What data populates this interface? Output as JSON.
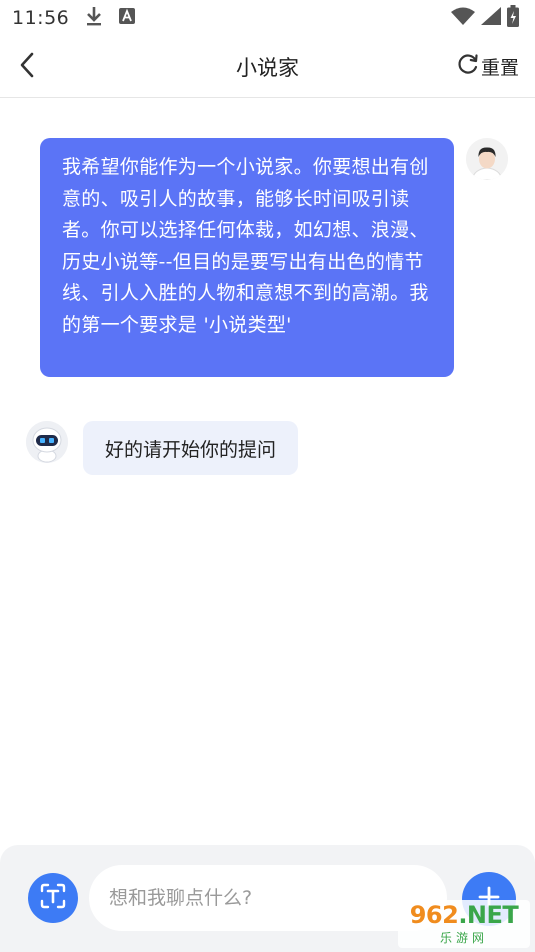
{
  "status_bar": {
    "time": "11:56",
    "icons": [
      "download-icon",
      "a-badge-icon",
      "wifi-icon",
      "signal-icon",
      "battery-icon"
    ]
  },
  "nav": {
    "title": "小说家",
    "back_icon": "chevron-left-icon",
    "reset_icon": "refresh-icon",
    "reset_label": "重置"
  },
  "messages": [
    {
      "sender": "user",
      "avatar_icon": "user-avatar-icon",
      "text": "我希望你能作为一个小说家。你要想出有创意的、吸引人的故事，能够长时间吸引读者。你可以选择任何体裁，如幻想、浪漫、历史小说等--但目的是要写出有出色的情节线、引人入胜的人物和意想不到的高潮。我的第一个要求是 '小说类型'"
    },
    {
      "sender": "bot",
      "avatar_icon": "robot-avatar-icon",
      "text": "好的请开始你的提问"
    }
  ],
  "composer": {
    "mode_icon": "text-mode-icon",
    "input_value": "",
    "input_placeholder": "想和我聊点什么?",
    "add_icon": "plus-icon"
  },
  "watermark": {
    "logo_part1": "962",
    "logo_part2": ".NET",
    "sub": "乐游网"
  },
  "colors": {
    "accent": "#3d7bf5",
    "user_bubble": "#5b74f6",
    "bot_bubble": "#edf1fb",
    "composer_bg": "#f2f3f5"
  }
}
